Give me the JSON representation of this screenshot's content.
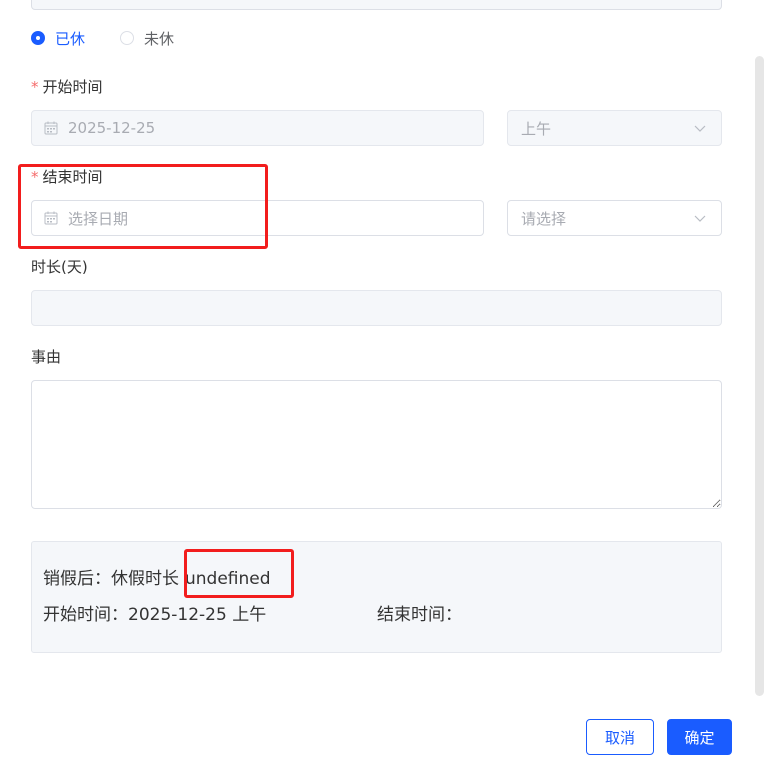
{
  "status_radio": {
    "options": [
      {
        "label": "已休",
        "checked": true
      },
      {
        "label": "未休",
        "checked": false
      }
    ]
  },
  "start_time": {
    "label": "开始时间",
    "required_mark": "*",
    "date_value": "2025-12-25",
    "period_value": "上午"
  },
  "end_time": {
    "label": "结束时间",
    "required_mark": "*",
    "date_placeholder": "选择日期",
    "period_placeholder": "请选择"
  },
  "duration": {
    "label": "时长(天)",
    "value": ""
  },
  "reason": {
    "label": "事由",
    "value": ""
  },
  "summary": {
    "duration_prefix": "销假后：休假时长",
    "duration_value": "undefined",
    "start_prefix": "开始时间：",
    "start_value": "2025-12-25 上午",
    "end_prefix": "结束时间："
  },
  "footer": {
    "cancel_label": "取消",
    "confirm_label": "确定"
  },
  "colors": {
    "primary": "#1a5cff",
    "required": "#f56c6c",
    "annotation": "#f21d1d",
    "panel_bg": "#f5f7fa"
  },
  "icons": {
    "date_icon": "calendar-icon",
    "select_icon": "chevron-down-icon"
  }
}
